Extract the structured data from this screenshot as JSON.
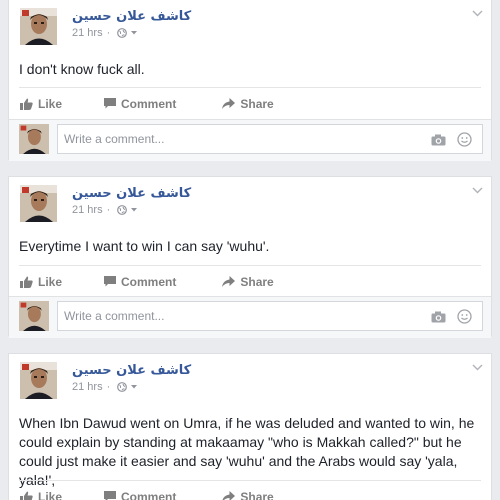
{
  "posts": [
    {
      "author": "كاشف علان حسين",
      "time": "21 hrs",
      "separator": "·",
      "text": "I don't know fuck all.",
      "actions": {
        "like": "Like",
        "comment": "Comment",
        "share": "Share"
      },
      "comment_placeholder": "Write a comment..."
    },
    {
      "author": "كاشف علان حسين",
      "time": "21 hrs",
      "separator": "·",
      "text": "Everytime I want to win I can say 'wuhu'.",
      "actions": {
        "like": "Like",
        "comment": "Comment",
        "share": "Share"
      },
      "comment_placeholder": "Write a comment..."
    },
    {
      "author": "كاشف علان حسين",
      "time": "21 hrs",
      "separator": "·",
      "text": "When Ibn Dawud went on Umra, if he was deluded and wanted to win, he could explain by standing at makaamay \"who is Makkah called?\" but he could just make it easier and say 'wuhu' and the Arabs would say 'yala, yala!',",
      "actions": {
        "like": "Like",
        "comment": "Comment",
        "share": "Share"
      }
    }
  ],
  "colors": {
    "author_link": "#365899",
    "meta_gray": "#90949c",
    "action_gray": "#7f7f7f",
    "background": "#e9ebee"
  },
  "icons": [
    "globe-icon",
    "caret-down-icon",
    "chevron-down-icon",
    "like-icon",
    "comment-icon",
    "share-icon",
    "camera-icon",
    "smiley-icon"
  ]
}
